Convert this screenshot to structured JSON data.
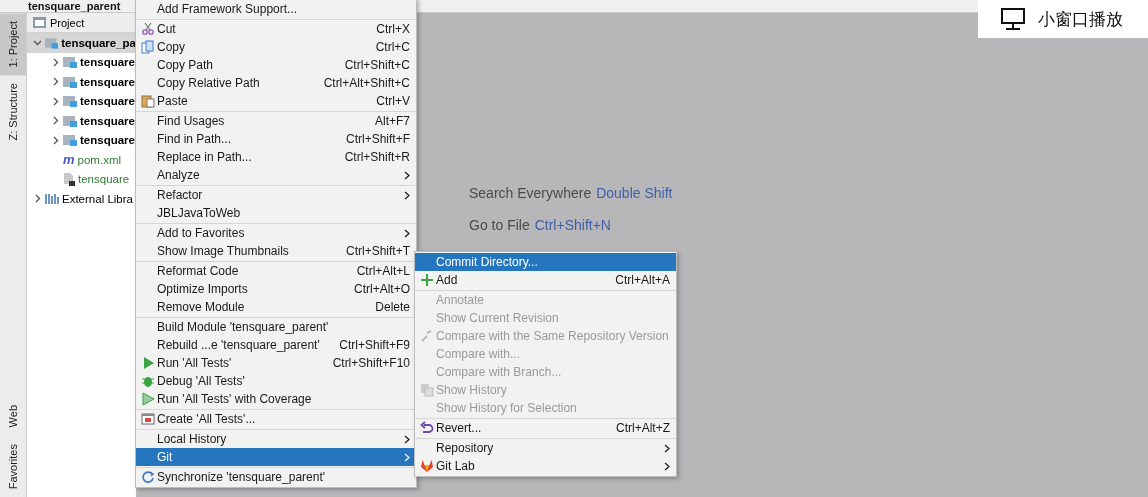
{
  "window": {
    "title": "tensquare_parent"
  },
  "tool_strip": {
    "top": [
      {
        "label": "1: Project",
        "selected": true
      },
      {
        "label": "Z: Structure",
        "selected": false
      }
    ],
    "bottom": [
      {
        "label": "Web",
        "selected": false
      },
      {
        "label": "Favorites",
        "selected": false
      }
    ]
  },
  "project_panel": {
    "title": "Project",
    "tree": [
      {
        "label": "tensquare_pa",
        "kind": "module",
        "expanded": true,
        "color": "#000000",
        "children": [
          {
            "label": "tensquare",
            "kind": "module",
            "expanded": false,
            "color": "#000000"
          },
          {
            "label": "tensquare",
            "kind": "module",
            "expanded": false,
            "color": "#000000"
          },
          {
            "label": "tensquare",
            "kind": "module",
            "expanded": false,
            "color": "#000000"
          },
          {
            "label": "tensquare",
            "kind": "module",
            "expanded": false,
            "color": "#000000"
          },
          {
            "label": "tensquare",
            "kind": "module",
            "expanded": false,
            "color": "#000000"
          },
          {
            "label": "pom.xml",
            "kind": "maven",
            "glyph": "m",
            "color": "#2e7d32"
          },
          {
            "label": "tensquare",
            "kind": "iml",
            "color": "#2e7d32"
          }
        ]
      },
      {
        "label": "External Libra",
        "kind": "library",
        "expanded": false,
        "color": "#000000"
      }
    ]
  },
  "context_menu": {
    "groups": [
      [
        {
          "label": "Add Framework Support...",
          "selected": false
        }
      ],
      [
        {
          "label": "Cut",
          "shortcut": "Ctrl+X",
          "kind": "scissors",
          "selected": false
        },
        {
          "label": "Copy",
          "shortcut": "Ctrl+C",
          "kind": "copy",
          "selected": false
        },
        {
          "label": "Copy Path",
          "shortcut": "Ctrl+Shift+C",
          "selected": false
        },
        {
          "label": "Copy Relative Path",
          "shortcut": "Ctrl+Alt+Shift+C",
          "selected": false
        },
        {
          "label": "Paste",
          "shortcut": "Ctrl+V",
          "kind": "paste",
          "selected": false
        }
      ],
      [
        {
          "label": "Find Usages",
          "shortcut": "Alt+F7",
          "selected": false
        },
        {
          "label": "Find in Path...",
          "shortcut": "Ctrl+Shift+F",
          "selected": false
        },
        {
          "label": "Replace in Path...",
          "shortcut": "Ctrl+Shift+R",
          "selected": false
        },
        {
          "label": "Analyze",
          "submenu": true,
          "selected": false
        }
      ],
      [
        {
          "label": "Refactor",
          "submenu": true,
          "selected": false
        },
        {
          "label": "JBLJavaToWeb",
          "selected": false
        }
      ],
      [
        {
          "label": "Add to Favorites",
          "submenu": true,
          "selected": false
        },
        {
          "label": "Show Image Thumbnails",
          "shortcut": "Ctrl+Shift+T",
          "selected": false
        }
      ],
      [
        {
          "label": "Reformat Code",
          "shortcut": "Ctrl+Alt+L",
          "selected": false
        },
        {
          "label": "Optimize Imports",
          "shortcut": "Ctrl+Alt+O",
          "selected": false
        },
        {
          "label": "Remove Module",
          "shortcut": "Delete",
          "selected": false
        }
      ],
      [
        {
          "label": "Build Module 'tensquare_parent'",
          "selected": false
        },
        {
          "label": "Rebuild ...e 'tensquare_parent'",
          "shortcut": "Ctrl+Shift+F9",
          "selected": false
        },
        {
          "label": "Run 'All Tests'",
          "shortcut": "Ctrl+Shift+F10",
          "kind": "run",
          "selected": false
        },
        {
          "label": "Debug 'All Tests'",
          "kind": "debug",
          "selected": false
        },
        {
          "label": "Run 'All Tests' with Coverage",
          "kind": "coverage",
          "selected": false
        }
      ],
      [
        {
          "label": "Create 'All Tests'...",
          "kind": "test",
          "selected": false
        }
      ],
      [
        {
          "label": "Local History",
          "submenu": true,
          "selected": false
        },
        {
          "label": "Git",
          "submenu": true,
          "selected": true
        }
      ],
      [
        {
          "label": "Synchronize 'tensquare_parent'",
          "kind": "sync",
          "selected": false
        }
      ]
    ]
  },
  "git_submenu": {
    "groups": [
      [
        {
          "label": "Commit Directory...",
          "selected": true,
          "disabled": false
        },
        {
          "label": "Add",
          "shortcut": "Ctrl+Alt+A",
          "kind": "plus",
          "selected": false,
          "disabled": false
        }
      ],
      [
        {
          "label": "Annotate",
          "selected": false,
          "disabled": true
        },
        {
          "label": "Show Current Revision",
          "selected": false,
          "disabled": true
        },
        {
          "label": "Compare with the Same Repository Version",
          "kind": "compare",
          "selected": false,
          "disabled": true
        },
        {
          "label": "Compare with...",
          "selected": false,
          "disabled": true
        },
        {
          "label": "Compare with Branch...",
          "selected": false,
          "disabled": true
        },
        {
          "label": "Show History",
          "kind": "history",
          "selected": false,
          "disabled": true
        },
        {
          "label": "Show History for Selection",
          "selected": false,
          "disabled": true
        }
      ],
      [
        {
          "label": "Revert...",
          "shortcut": "Ctrl+Alt+Z",
          "kind": "revert",
          "selected": false,
          "disabled": false
        }
      ],
      [
        {
          "label": "Repository",
          "submenu": true,
          "selected": false,
          "disabled": false
        },
        {
          "label": "Git Lab",
          "submenu": true,
          "kind": "gitlab",
          "selected": false,
          "disabled": false
        }
      ]
    ]
  },
  "editor_hints": [
    {
      "label": "Search Everywhere",
      "shortcut": "Double Shift"
    },
    {
      "label": "Go to File",
      "shortcut": "Ctrl+Shift+N"
    }
  ],
  "video_overlay": {
    "label": "小窗口播放"
  }
}
